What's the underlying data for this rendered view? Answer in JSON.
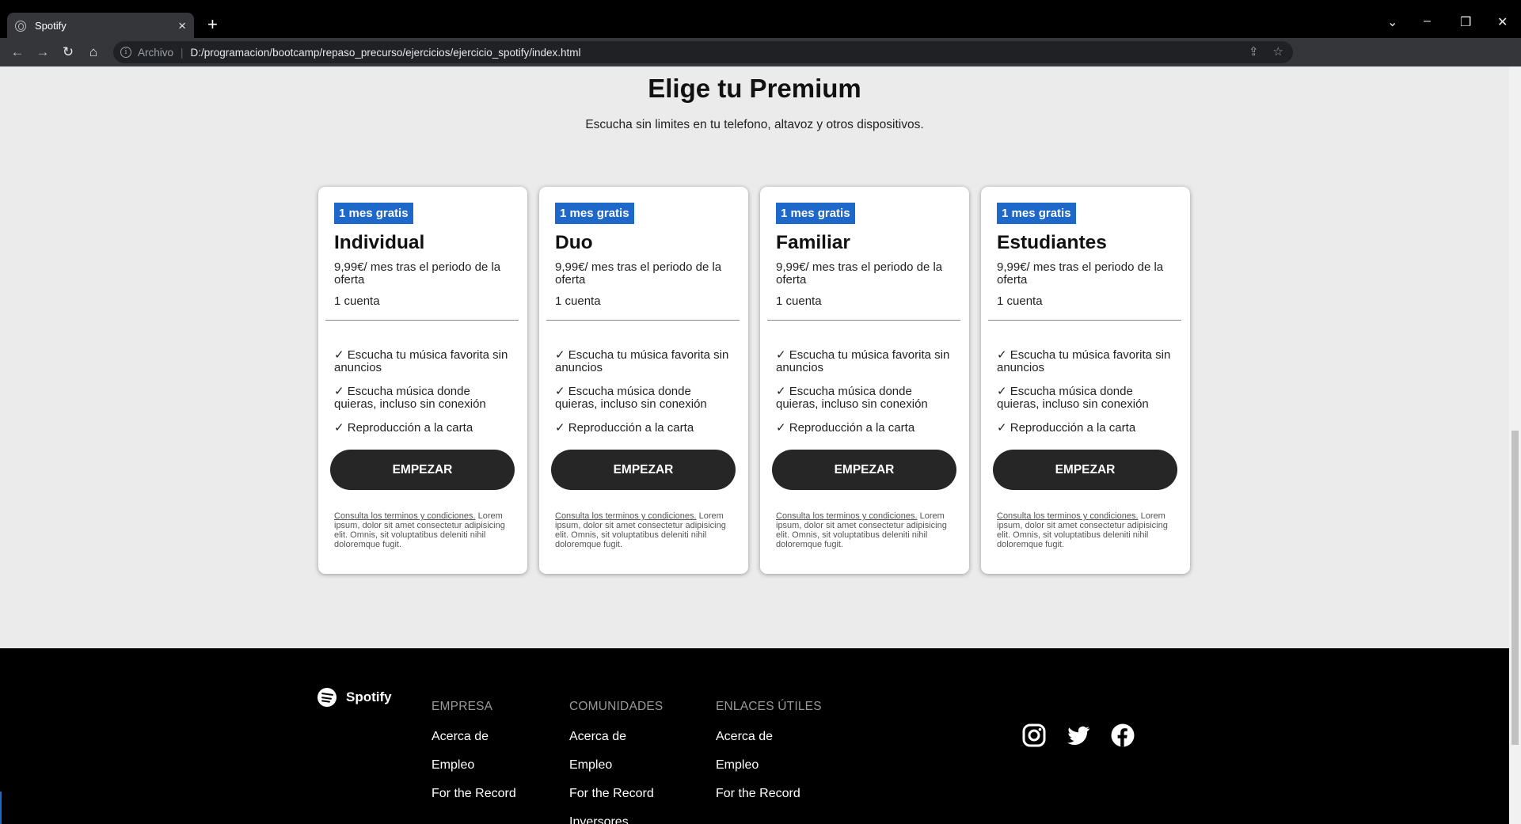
{
  "browser": {
    "tab_title": "Spotify",
    "new_tab": "+",
    "tab_close": "×",
    "scheme": "Archivo",
    "url": "D:/programacion/bootcamp/repaso_precurso/ejercicios/ejercicio_spotify/index.html"
  },
  "page": {
    "title": "Elige tu Premium",
    "subtitle": "Escucha sin limites en tu telefono, altavoz y otros dispositivos."
  },
  "plans": [
    {
      "badge": "1 mes gratis",
      "name": "Individual",
      "price": "9,99€/ mes tras el periodo de la oferta",
      "accounts": "1 cuenta",
      "features": [
        "✓ Escucha tu música favorita sin anuncios",
        "✓ Escucha música donde quieras, incluso sin conexión",
        "✓ Reproducción a la carta"
      ],
      "cta": "EMPEZAR",
      "terms_link": "Consulta los terminos y condiciones.",
      "terms_text": " Lorem ipsum, dolor sit amet consectetur adipisicing elit. Omnis, sit voluptatibus deleniti nihil doloremque fugit."
    },
    {
      "badge": "1 mes gratis",
      "name": "Duo",
      "price": "9,99€/ mes tras el periodo de la oferta",
      "accounts": "1 cuenta",
      "features": [
        "✓ Escucha tu música favorita sin anuncios",
        "✓ Escucha música donde quieras, incluso sin conexión",
        "✓ Reproducción a la carta"
      ],
      "cta": "EMPEZAR",
      "terms_link": "Consulta los terminos y condiciones.",
      "terms_text": " Lorem ipsum, dolor sit amet consectetur adipisicing elit. Omnis, sit voluptatibus deleniti nihil doloremque fugit."
    },
    {
      "badge": "1 mes gratis",
      "name": "Familiar",
      "price": "9,99€/ mes tras el periodo de la oferta",
      "accounts": "1 cuenta",
      "features": [
        "✓ Escucha tu música favorita sin anuncios",
        "✓ Escucha música donde quieras, incluso sin conexión",
        "✓ Reproducción a la carta"
      ],
      "cta": "EMPEZAR",
      "terms_link": "Consulta los terminos y condiciones.",
      "terms_text": " Lorem ipsum, dolor sit amet consectetur adipisicing elit. Omnis, sit voluptatibus deleniti nihil doloremque fugit."
    },
    {
      "badge": "1 mes gratis",
      "name": "Estudiantes",
      "price": "9,99€/ mes tras el periodo de la oferta",
      "accounts": "1 cuenta",
      "features": [
        "✓ Escucha tu música favorita sin anuncios",
        "✓ Escucha música donde quieras, incluso sin conexión",
        "✓ Reproducción a la carta"
      ],
      "cta": "EMPEZAR",
      "terms_link": "Consulta los terminos y condiciones.",
      "terms_text": " Lorem ipsum, dolor sit amet consectetur adipisicing elit. Omnis, sit voluptatibus deleniti nihil doloremque fugit."
    }
  ],
  "footer": {
    "brand": "Spotify",
    "columns": [
      {
        "heading": "EMPRESA",
        "links": [
          "Acerca de",
          "Empleo",
          "For the Record"
        ]
      },
      {
        "heading": "COMUNIDADES",
        "links": [
          "Acerca de",
          "Empleo",
          "For the Record",
          "Inversores"
        ]
      },
      {
        "heading": "ENLACES ÚTILES",
        "links": [
          "Acerca de",
          "Empleo",
          "For the Record"
        ]
      }
    ],
    "socials": [
      "instagram-icon",
      "twitter-icon",
      "facebook-icon"
    ]
  },
  "colors": {
    "badge": "#1e68c9",
    "button": "#262626",
    "page_bg": "#ebebeb",
    "footer_bg": "#000000"
  }
}
